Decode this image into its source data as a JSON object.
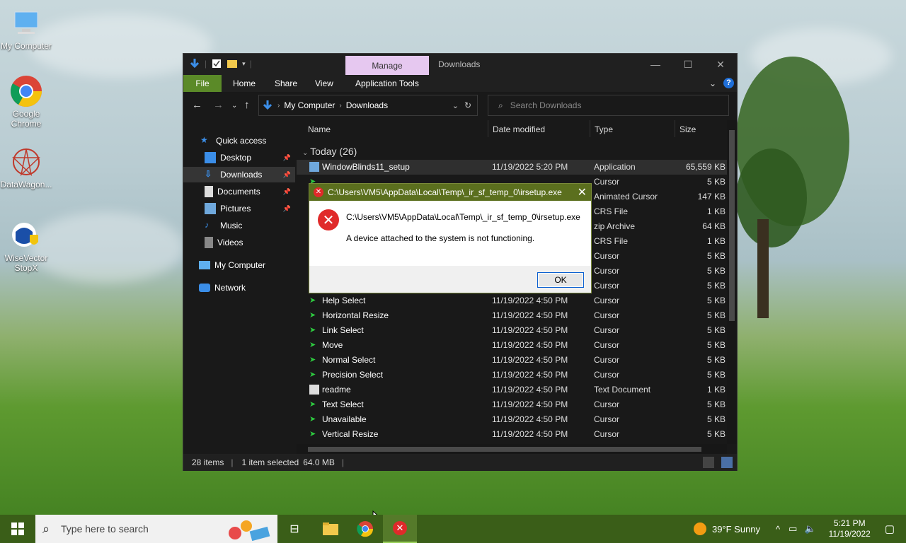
{
  "desktop": {
    "icons": [
      {
        "label": "My Computer"
      },
      {
        "label": "Google Chrome"
      },
      {
        "label": "DataWagon..."
      },
      {
        "label": "WiseVector StopX"
      }
    ]
  },
  "explorer": {
    "manage_tab": "Manage",
    "title": "Downloads",
    "ribbon_tabs": [
      "File",
      "Home",
      "Share",
      "View",
      "Application Tools"
    ],
    "breadcrumb": [
      "My Computer",
      "Downloads"
    ],
    "search_placeholder": "Search Downloads",
    "nav": {
      "quick_access": "Quick access",
      "items": [
        "Desktop",
        "Downloads",
        "Documents",
        "Pictures",
        "Music",
        "Videos"
      ],
      "my_computer": "My Computer",
      "network": "Network"
    },
    "columns": [
      "Name",
      "Date modified",
      "Type",
      "Size"
    ],
    "group": "Today (26)",
    "rows": [
      {
        "name": "WindowBlinds11_setup",
        "date": "11/19/2022 5:20 PM",
        "type": "Application",
        "size": "65,559 KB"
      },
      {
        "name": "",
        "date": "",
        "type": "Cursor",
        "size": "5 KB"
      },
      {
        "name": "",
        "date": "",
        "type": "Animated Cursor",
        "size": "147 KB"
      },
      {
        "name": "",
        "date": "",
        "type": "CRS File",
        "size": "1 KB"
      },
      {
        "name": "",
        "date": "",
        "type": "zip Archive",
        "size": "64 KB"
      },
      {
        "name": "",
        "date": "",
        "type": "CRS File",
        "size": "1 KB"
      },
      {
        "name": "",
        "date": "",
        "type": "Cursor",
        "size": "5 KB"
      },
      {
        "name": "",
        "date": "",
        "type": "Cursor",
        "size": "5 KB"
      },
      {
        "name": "",
        "date": "",
        "type": "Cursor",
        "size": "5 KB"
      },
      {
        "name": "Help Select",
        "date": "11/19/2022 4:50 PM",
        "type": "Cursor",
        "size": "5 KB"
      },
      {
        "name": "Horizontal Resize",
        "date": "11/19/2022 4:50 PM",
        "type": "Cursor",
        "size": "5 KB"
      },
      {
        "name": "Link Select",
        "date": "11/19/2022 4:50 PM",
        "type": "Cursor",
        "size": "5 KB"
      },
      {
        "name": "Move",
        "date": "11/19/2022 4:50 PM",
        "type": "Cursor",
        "size": "5 KB"
      },
      {
        "name": "Normal Select",
        "date": "11/19/2022 4:50 PM",
        "type": "Cursor",
        "size": "5 KB"
      },
      {
        "name": "Precision Select",
        "date": "11/19/2022 4:50 PM",
        "type": "Cursor",
        "size": "5 KB"
      },
      {
        "name": "readme",
        "date": "11/19/2022 4:50 PM",
        "type": "Text Document",
        "size": "1 KB"
      },
      {
        "name": "Text Select",
        "date": "11/19/2022 4:50 PM",
        "type": "Cursor",
        "size": "5 KB"
      },
      {
        "name": "Unavailable",
        "date": "11/19/2022 4:50 PM",
        "type": "Cursor",
        "size": "5 KB"
      },
      {
        "name": "Vertical Resize",
        "date": "11/19/2022 4:50 PM",
        "type": "Cursor",
        "size": "5 KB"
      }
    ],
    "status": {
      "count": "28 items",
      "selected": "1 item selected",
      "size": "64.0 MB"
    }
  },
  "dialog": {
    "title": "C:\\Users\\VM5\\AppData\\Local\\Temp\\_ir_sf_temp_0\\irsetup.exe",
    "path": "C:\\Users\\VM5\\AppData\\Local\\Temp\\_ir_sf_temp_0\\irsetup.exe",
    "message": "A device attached to the system is not functioning.",
    "ok": "OK"
  },
  "taskbar": {
    "search_placeholder": "Type here to search",
    "weather": "39°F  Sunny",
    "time": "5:21 PM",
    "date": "11/19/2022"
  }
}
